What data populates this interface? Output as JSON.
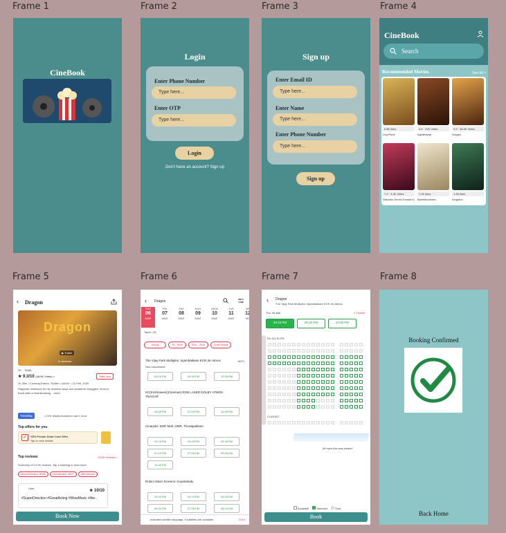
{
  "frames": [
    "Frame 1",
    "Frame 2",
    "Frame 3",
    "Frame 4",
    "Frame 5",
    "Frame 6",
    "Frame 7",
    "Frame 8"
  ],
  "app_name": "CineBook",
  "login": {
    "title": "Login",
    "phone_label": "Enter Phone Number",
    "phone_placeholder": "Type here...",
    "otp_label": "Enter OTP",
    "otp_placeholder": "Type here...",
    "button": "Login",
    "signup_prompt": "Don't have an account? Sign up"
  },
  "signup": {
    "title": "Sign up",
    "email_label": "Enter Email ID",
    "email_placeholder": "Type here...",
    "name_label": "Enter Name",
    "name_placeholder": "Type here...",
    "phone_label": "Enter Phone Number",
    "phone_placeholder": "Type here...",
    "button": "Sign up"
  },
  "home": {
    "search_placeholder": "Search",
    "section_title": "Recommended Movies",
    "see_all": "See All >",
    "movies": [
      {
        "title": "Leg Piece",
        "rating": "6.8K likes",
        "color": "#b68c3e"
      },
      {
        "title": "Aghathiyaa",
        "rating": "4.5 · 22K Votes",
        "color": "#5a2f1c"
      },
      {
        "title": "Dragon",
        "rating": "9.3 · 46.4K Votes",
        "color": "#a24a22"
      },
      {
        "title": "Nilavuku Enmel Ennadi Kobam",
        "rating": "7.9 · 3.4K Votes",
        "color": "#7a1f3a"
      },
      {
        "title": "Banthikoondan",
        "rating": "1.2K likes",
        "color": "#d7c9a8"
      },
      {
        "title": "Kingston",
        "rating": "1.9K likes",
        "color": "#1f4a34"
      }
    ]
  },
  "detail": {
    "title": "Dragon",
    "trailer": "▶ Trailer",
    "in_cinemas": "In cinemas",
    "formats": [
      "2D",
      "TAMIL"
    ],
    "rating": "★ 9.3/10",
    "votes": "(46.5K Votes) >",
    "rate_now": "Rate now",
    "meta": "2h 35m • Comedy,Drama, Thriller • UA16+ • 21 Feb, 2025",
    "synopsis": "Ragavan, infamous for his reckless ways and academic struggles, turns to fraud after a heartbreaking ...more",
    "trending": "Trending",
    "booked": "1.37K tickets booked in last 1 hour",
    "offers_title": "Top offers for you",
    "offer_text": "YES Private Debit Card Offer",
    "offer_sub": "Tap to view details",
    "reviews_title": "Top reviews",
    "reviews_link": "32.9K reviews >",
    "reviews_summary": "Summary of 24.9K reviews. Tap a hashtag to read more",
    "tags": [
      "#SuperDirection 16985",
      "#GreatActing 18027",
      "#Blockbuster"
    ],
    "review_user": "User",
    "review_score": "★ 10/10",
    "review_text": "#SuperDirection #GreatActing #WowMusic #Aw...",
    "book_button": "Book Now"
  },
  "showtimes": {
    "title": "Dragon",
    "days": [
      {
        "dow": "THU",
        "date": "06",
        "mon": "MAR"
      },
      {
        "dow": "FRI",
        "date": "07",
        "mon": "MAR"
      },
      {
        "dow": "SAT",
        "date": "08",
        "mon": "MAR"
      },
      {
        "dow": "SUN",
        "date": "09",
        "mon": "MAR"
      },
      {
        "dow": "MON",
        "date": "10",
        "mon": "MAR"
      },
      {
        "dow": "TUE",
        "date": "11",
        "mon": "MAR"
      },
      {
        "dow": "WE",
        "date": "12",
        "mon": "MA"
      }
    ],
    "language": "Tamil • 2D",
    "filters": [
      "Sort by",
      "₹0 - ₹100",
      "₹101 - ₹200",
      "Close Shows"
    ],
    "theatres": [
      {
        "name": "The Vijay Park Multiplex: Injambakkam ECR 4K Atmos",
        "times": [
          "03:15 PM",
          "06:30 PM",
          "10:05 PM"
        ]
      },
      {
        "name": "KC(Krishnaveni)Cinemas) RGB LASER DOLBY ATMOS TNAGAR",
        "times": [
          "03:00 PM",
          "07:00 PM",
          "10:30 PM"
        ]
      },
      {
        "name": "Cinepolis: BSR Mall, OMR, Thoraipakkam",
        "times": [
          "03:15 PM",
          "04:20 PM",
          "06:30 PM",
          "07:10 PM",
          "07:55 PM",
          "09:45 PM",
          "10:40 PM"
        ]
      },
      {
        "name": "Rohini Silver Screens: Koyambedu",
        "times": [
          "03:45 PM",
          "04:10 PM",
          "05:00 PM",
          "06:30 PM",
          "07:30 PM",
          "08:15 PM"
        ]
      }
    ],
    "info": "INFO",
    "cancel": "Non-cancellable",
    "footnote": "Indicates subtitle language, if subtitles are available",
    "got_it": "Got it"
  },
  "seats": {
    "title": "Dragon",
    "venue": "The Vijay Park Multiplex: Injambakkam ECR 4K Atmos",
    "date": "Thu, 06 Mar",
    "tickets": "2 Tickets",
    "times": [
      "03:15 PM",
      "06:30 PM",
      "10:05 PM"
    ],
    "elite": "Rs.192 ELITE",
    "classic": "CLASSIC",
    "screen_text": "All eyes this way please!",
    "legend": [
      "Available",
      "Selected",
      "Sold"
    ],
    "book_button": "Book"
  },
  "confirm": {
    "title": "Booking Confirmed",
    "back": "Back Home"
  },
  "colors": {
    "teal": "#4a8d8c",
    "sand": "#e8d2a4",
    "accent": "#e84a5f",
    "green": "#2a9e4a"
  }
}
